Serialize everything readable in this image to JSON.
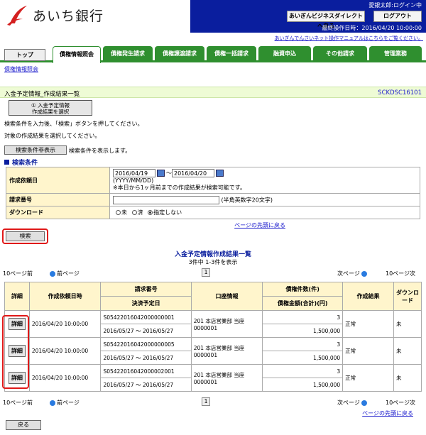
{
  "brand": {
    "name": "あいち銀行",
    "color": "#d42020"
  },
  "header": {
    "user": "愛銀太郎:ログイン中",
    "direct_button": "あいぎんビジネスダイレクトへ戻る",
    "logout_button": "ログアウト",
    "last_operation": "最終操作日時：2016/04/20 10:00:00",
    "manual_link": "あいぎんでんさいネット操作マニュアルはこちらをご覧ください。"
  },
  "tabs": [
    {
      "label": "トップ"
    },
    {
      "label": "債権情報照会"
    },
    {
      "label": "債権発生請求"
    },
    {
      "label": "債権譲渡請求"
    },
    {
      "label": "債権一括請求"
    },
    {
      "label": "融資申込"
    },
    {
      "label": "その他請求"
    },
    {
      "label": "管理業務"
    }
  ],
  "subnav": "債権情報照会",
  "page": {
    "title": "入金予定情報_作成結果一覧",
    "code": "SCKDSC16101",
    "step_line1": "① 入金予定情報",
    "step_line2": "作成結果を選択",
    "instruction1": "検索条件を入力後、「検索」ボタンを押してください。",
    "instruction2": "対象の作成結果を選択してください。",
    "toggle_button": "検索条件非表示",
    "toggle_note": "検索条件を表示します。",
    "section_title": "検索条件"
  },
  "search": {
    "date_label": "作成依頼日",
    "date_from": "2016/04/19",
    "date_to": "2016/04/20",
    "date_sep": "〜",
    "date_format": "(YYYY/MM/DD)",
    "date_note": "※本日から1ヶ月前までの作成結果が検索可能です。",
    "request_label": "請求番号",
    "request_value": "",
    "request_note": "(半角英数字20文字)",
    "download_label": "ダウンロード",
    "radio_options": [
      "未",
      "済",
      "指定しない"
    ],
    "top_link": "ページの先頭に戻る",
    "search_button": "検索"
  },
  "results": {
    "title": "入金予定情報作成結果一覧",
    "count": "3件中 1-3件を表示",
    "prev10": "10ページ前",
    "prev": "前ページ",
    "next": "次ページ",
    "next10": "10ページ次",
    "page_number": "1",
    "headers": {
      "detail": "詳細",
      "date": "作成依頼日時",
      "request_no": "請求番号",
      "settlement": "決済予定日",
      "account": "口座情報",
      "count": "債権件数(件)",
      "amount": "債権金額(合計)(円)",
      "result": "作成結果",
      "download": "ダウンロード"
    },
    "detail_button": "詳細",
    "rows": [
      {
        "date": "2016/04/20 10:00:00",
        "request_no": "S05422016042000000001",
        "settlement": "2016/05/27 〜 2016/05/27",
        "account": "201 本店営業部 当座 0000001",
        "count": "3",
        "amount": "1,500,000",
        "result": "正常",
        "download": "未"
      },
      {
        "date": "2016/04/20 10:00:00",
        "request_no": "S05422016042000000005",
        "settlement": "2016/05/27 〜 2016/05/27",
        "account": "201 本店営業部 当座 0000001",
        "count": "3",
        "amount": "1,500,000",
        "result": "正常",
        "download": "未"
      },
      {
        "date": "2016/04/20 10:00:00",
        "request_no": "S05422016042000002001",
        "settlement": "2016/05/27 〜 2016/05/27",
        "account": "201 本店営業部 当座 0000001",
        "count": "3",
        "amount": "1,500,000",
        "result": "正常",
        "download": "未"
      }
    ],
    "top_link": "ページの先頭に戻る",
    "back_button": "戻る"
  }
}
